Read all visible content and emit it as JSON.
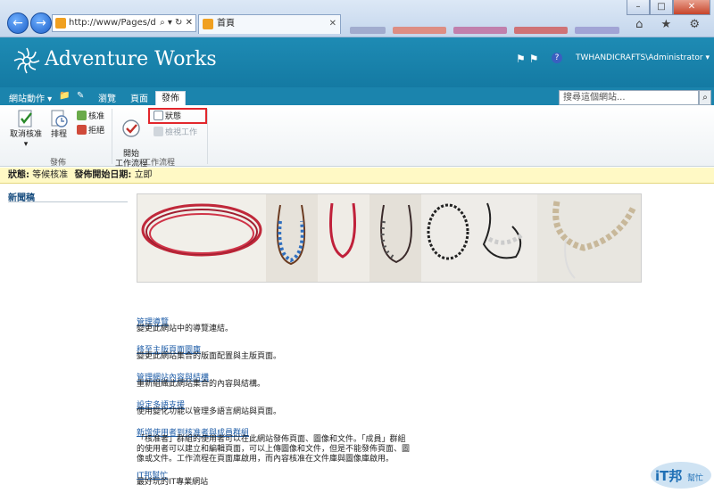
{
  "browser": {
    "address": "http://www/Pages/d",
    "address_controls": "⌕ ▾ ↻ ✕",
    "tab_title": "首頁",
    "tab_close": "✕",
    "window_controls": [
      "–",
      "□",
      "✕"
    ],
    "toolbar_icons": "⌂ ★ ⚙"
  },
  "site": {
    "title": "Adventure Works",
    "user": "TWHANDICRAFTS\\Administrator ▾",
    "accent_color": "#1b84ad"
  },
  "ribbon_tabs": {
    "site_actions": "網站動作 ▾",
    "browse": "瀏覽",
    "page": "頁面",
    "publish": "發佈"
  },
  "search": {
    "placeholder": "搜尋這個網站...",
    "button": "⌕"
  },
  "ribbon": {
    "cancel_approval": "取消核准",
    "cancel_approval_arrow": "▾",
    "schedule": "排程",
    "approve": "核准",
    "reject": "拒絕",
    "group_publish": "發佈",
    "start_workflow": "開始\n工作流程",
    "status": "狀態",
    "view_tasks": "檢視工作",
    "group_workflow": "工作流程"
  },
  "status_bar": {
    "status_label": "狀態:",
    "status_value": "等候核准",
    "start_label": "發佈開始日期:",
    "start_value": "立即"
  },
  "left_nav": {
    "title": "新聞稿"
  },
  "links": [
    {
      "title": "管理導覽",
      "desc": "變更此網站中的導覽連結。"
    },
    {
      "title": "移至主版頁面圖庫",
      "desc": "變更此網站集合的版面配置與主版頁面。"
    },
    {
      "title": "管理網站內容與結構",
      "desc": "重新組織此網站集合的內容與結構。"
    },
    {
      "title": "設定多語支援",
      "desc": "使用變化功能以管理多語言網站與頁面。"
    },
    {
      "title": "新增使用者到核准者與成員群組",
      "desc": "「核准者」群組的使用者可以在此網站發佈頁面、圖像和文件。「成員」群組\n的使用者可以建立和編輯頁面，可以上傳圖像和文件，但是不能發佈頁面、圖\n像或文件。工作流程在頁面庫啟用，而內容核准在文件庫與圖像庫啟用。"
    },
    {
      "title": "IT邦幫忙",
      "desc": "最好玩的IT專業網站"
    }
  ],
  "watermark": {
    "text1": "iT邦",
    "text2": "幫忙"
  }
}
